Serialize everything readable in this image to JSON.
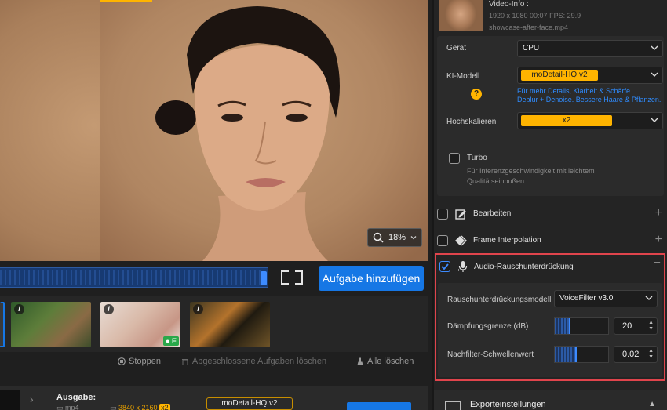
{
  "preview": {
    "zoom": "18%"
  },
  "timeline": {
    "add_task_label": "Aufgabe hinzufügen"
  },
  "thumbnails": {
    "info_glyph": "i",
    "badge": "E"
  },
  "task_actions": {
    "stop": "Stoppen",
    "clear_done": "Abgeschlossene Aufgaben löschen",
    "clear_all": "Alle löschen"
  },
  "output": {
    "label": "Ausgabe:",
    "format": "mp4",
    "resolution": "3840 x 2160",
    "scale_badge": "x2",
    "model": "moDetail-HQ  v2"
  },
  "video_info": {
    "title": "Video-Info :",
    "meta": "1920 x 1080  00:07    FPS: 29.9",
    "filename": "showcase-after-face.mp4"
  },
  "settings": {
    "device_label": "Gerät",
    "device_value": "CPU",
    "model_label": "KI-Modell",
    "model_value": "moDetail-HQ  v2",
    "model_hint_1": "Für mehr Details, Klarheit & Schärfe.",
    "model_hint_2": "Deblur + Denoise. Bessere Haare & Pflanzen.",
    "upscale_label": "Hochskalieren",
    "upscale_value": "x2",
    "turbo_label": "Turbo",
    "turbo_desc": "Für Inferenzgeschwindigkeit mit leichtem Qualitätseinbußen"
  },
  "sections": {
    "edit": "Bearbeiten",
    "frame_interp": "Frame Interpolation",
    "audio": "Audio-Rauschunterdrückung"
  },
  "audio": {
    "model_label": "Rauschunterdrückungsmodell",
    "model_value": "VoiceFilter v3.0",
    "damping_label": "Dämpfungsgrenze (dB)",
    "damping_value": "20",
    "damping_level": 0.285,
    "postfilter_label": "Nachfilter-Schwellenwert",
    "postfilter_value": "0.02",
    "postfilter_level": 0.4
  },
  "export": {
    "label": "Exporteinstellungen"
  },
  "colors": {
    "accent_blue": "#1677e5",
    "accent_yellow": "#ffb400",
    "highlight_red": "#e0444c"
  }
}
